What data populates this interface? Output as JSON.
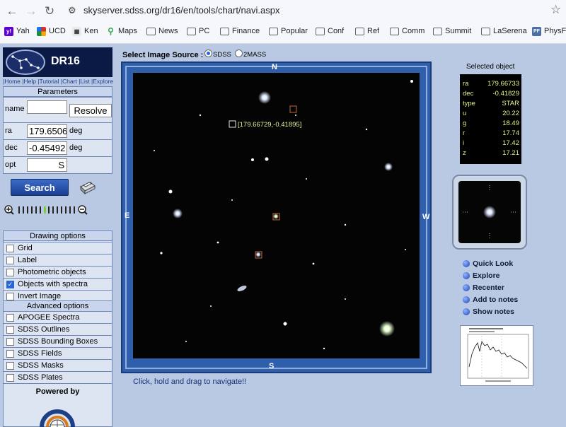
{
  "browser": {
    "url": "skyserver.sdss.org/dr16/en/tools/chart/navi.aspx",
    "bookmarks": [
      {
        "label": "Yah",
        "icon": "yahoo-icon"
      },
      {
        "label": "UCD",
        "icon": "ucd-icon"
      },
      {
        "label": "Ken",
        "icon": "ken-icon"
      },
      {
        "label": "Maps",
        "icon": "maps-icon"
      },
      {
        "label": "News",
        "icon": "folder-icon"
      },
      {
        "label": "PC",
        "icon": "folder-icon"
      },
      {
        "label": "Finance",
        "icon": "folder-icon"
      },
      {
        "label": "Popular",
        "icon": "folder-icon"
      },
      {
        "label": "Conf",
        "icon": "folder-icon"
      },
      {
        "label": "Ref",
        "icon": "folder-icon"
      },
      {
        "label": "Comm",
        "icon": "folder-icon"
      },
      {
        "label": "Summit",
        "icon": "folder-icon"
      },
      {
        "label": "LaSerena",
        "icon": "folder-icon"
      },
      {
        "label": "PhysF",
        "icon": "physf-icon"
      }
    ]
  },
  "logo": {
    "title": "DR16"
  },
  "toplinks": "|Home |Help |Tutorial |Chart |List |Explore |",
  "parameters": {
    "header": "Parameters",
    "name_label": "name",
    "name_value": "",
    "resolve_label": "Resolve",
    "ra_label": "ra",
    "ra_value": "179.6506",
    "ra_unit": "deg",
    "dec_label": "dec",
    "dec_value": "-0.45492",
    "dec_unit": "deg",
    "opt_label": "opt",
    "opt_value": "S"
  },
  "search_label": "Search",
  "drawing": {
    "header": "Drawing options",
    "items": [
      {
        "label": "Grid",
        "checked": false
      },
      {
        "label": "Label",
        "checked": false
      },
      {
        "label": "Photometric objects",
        "checked": false
      },
      {
        "label": "Objects with spectra",
        "checked": true
      },
      {
        "label": "Invert Image",
        "checked": false
      }
    ]
  },
  "advanced": {
    "header": "Advanced options",
    "items": [
      {
        "label": "APOGEE Spectra",
        "checked": false
      },
      {
        "label": "SDSS Outlines",
        "checked": false
      },
      {
        "label": "SDSS Bounding Boxes",
        "checked": false
      },
      {
        "label": "SDSS Fields",
        "checked": false
      },
      {
        "label": "SDSS Masks",
        "checked": false
      },
      {
        "label": "SDSS Plates",
        "checked": false
      }
    ]
  },
  "powered_by": "Powered by",
  "image_source": {
    "label": "Select Image Source :",
    "options": [
      "SDSS",
      "2MASS"
    ],
    "selected": "SDSS"
  },
  "directions": {
    "n": "N",
    "s": "S",
    "e": "E",
    "w": "W"
  },
  "sky_label": "[179.66729,-0.41895]",
  "nav_hint": "Click, hold and drag to navigate!!",
  "selected_object": {
    "title": "Selected object",
    "rows": [
      {
        "k": "ra",
        "v": "179.66733"
      },
      {
        "k": "dec",
        "v": "-0.41829"
      },
      {
        "k": "type",
        "v": "STAR"
      },
      {
        "k": "u",
        "v": "20.22"
      },
      {
        "k": "g",
        "v": "18.49"
      },
      {
        "k": "r",
        "v": "17.74"
      },
      {
        "k": "i",
        "v": "17.42"
      },
      {
        "k": "z",
        "v": "17.21"
      }
    ]
  },
  "actions": [
    "Quick Look",
    "Explore",
    "Recenter",
    "Add to notes",
    "Show notes"
  ],
  "colors": {
    "accent": "#2f5eaa",
    "panel": "#dde5f3",
    "page": "#b9c9e4",
    "object_text": "#e7f28a"
  }
}
